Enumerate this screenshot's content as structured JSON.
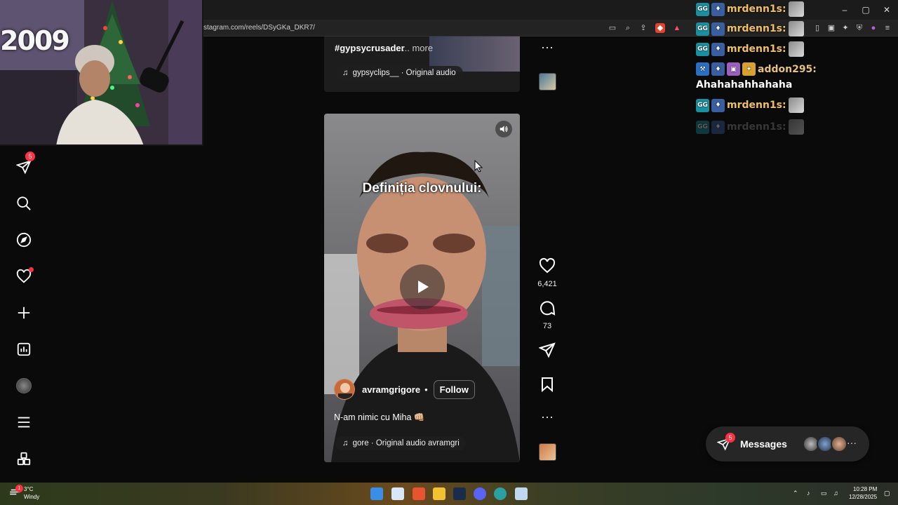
{
  "browser": {
    "url": "stagram.com/reels/DSyGKa_DKR7/",
    "window_controls": [
      "–",
      "▢",
      "✕"
    ]
  },
  "webcam": {
    "wall_text": "2009"
  },
  "sidebar": {
    "items": [
      {
        "name": "direct-icon",
        "badge": "5"
      },
      {
        "name": "search-icon"
      },
      {
        "name": "explore-icon"
      },
      {
        "name": "heart-icon",
        "dot": true
      },
      {
        "name": "create-icon"
      },
      {
        "name": "dashboard-icon"
      },
      {
        "name": "profile-avatar"
      },
      {
        "name": "menu-icon"
      },
      {
        "name": "apps-icon"
      }
    ]
  },
  "previous_reel": {
    "hashtag": "#gypsycrusader",
    "more": "... more",
    "audio": "gypsyclips__ · Original audio"
  },
  "reel": {
    "overlay_title": "Definiția clovnului:",
    "author": "avramgrigore",
    "bullet": "•",
    "follow": "Follow",
    "caption": "N-am nimic cu Miha 👊🏼",
    "audio": "gore · Original audio  avramgri"
  },
  "actions": {
    "likes": "6,421",
    "comments": "73"
  },
  "chat": {
    "lines": [
      {
        "user": "mrdenn1s:",
        "color": "#f0c060"
      },
      {
        "user": "mrdenn1s:",
        "color": "#f0c060"
      },
      {
        "user": "mrdenn1s:",
        "color": "#f0c060"
      },
      {
        "user": "addon295:",
        "color": "#e6c27a"
      },
      {
        "user": "mrdenn1s:",
        "color": "#f0c060"
      },
      {
        "user": "mrdenn1s:",
        "color": "#8a8a8a"
      }
    ],
    "message": "Ahahahahhahaha"
  },
  "messages": {
    "label": "Messages",
    "badge": "5",
    "more": "···"
  },
  "taskbar": {
    "temp": "3°C",
    "weather": "Windy",
    "weather_badge": "1",
    "time": "10:28 PM",
    "date": "12/28/2025"
  },
  "colors": {
    "accent_red": "#ff3040",
    "background": "#0a0a0a"
  }
}
